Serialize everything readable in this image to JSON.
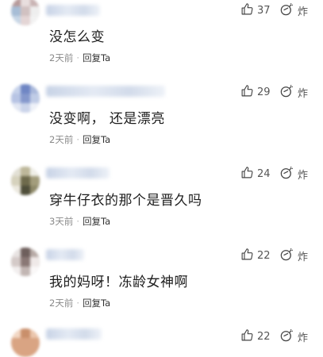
{
  "comments": [
    {
      "text": "没怎么变",
      "time": "2天前",
      "reply_label": "回复Ta",
      "likes": "37",
      "bomb_label": "炸"
    },
    {
      "text": "没变啊， 还是漂亮",
      "time": "2天前",
      "reply_label": "回复Ta",
      "likes": "29",
      "bomb_label": "炸"
    },
    {
      "text": "穿牛仔衣的那个是晋久吗",
      "time": "3天前",
      "reply_label": "回复Ta",
      "likes": "24",
      "bomb_label": "炸"
    },
    {
      "text": "我的妈呀！冻龄女神啊",
      "time": "2天前",
      "reply_label": "回复Ta",
      "likes": "22",
      "bomb_label": "炸"
    },
    {
      "text": "",
      "time": "",
      "reply_label": "",
      "likes": "22",
      "bomb_label": "炸"
    }
  ],
  "separator": "·",
  "icons": {
    "like": "thumbs-up-icon",
    "bomb": "bomb-icon"
  }
}
